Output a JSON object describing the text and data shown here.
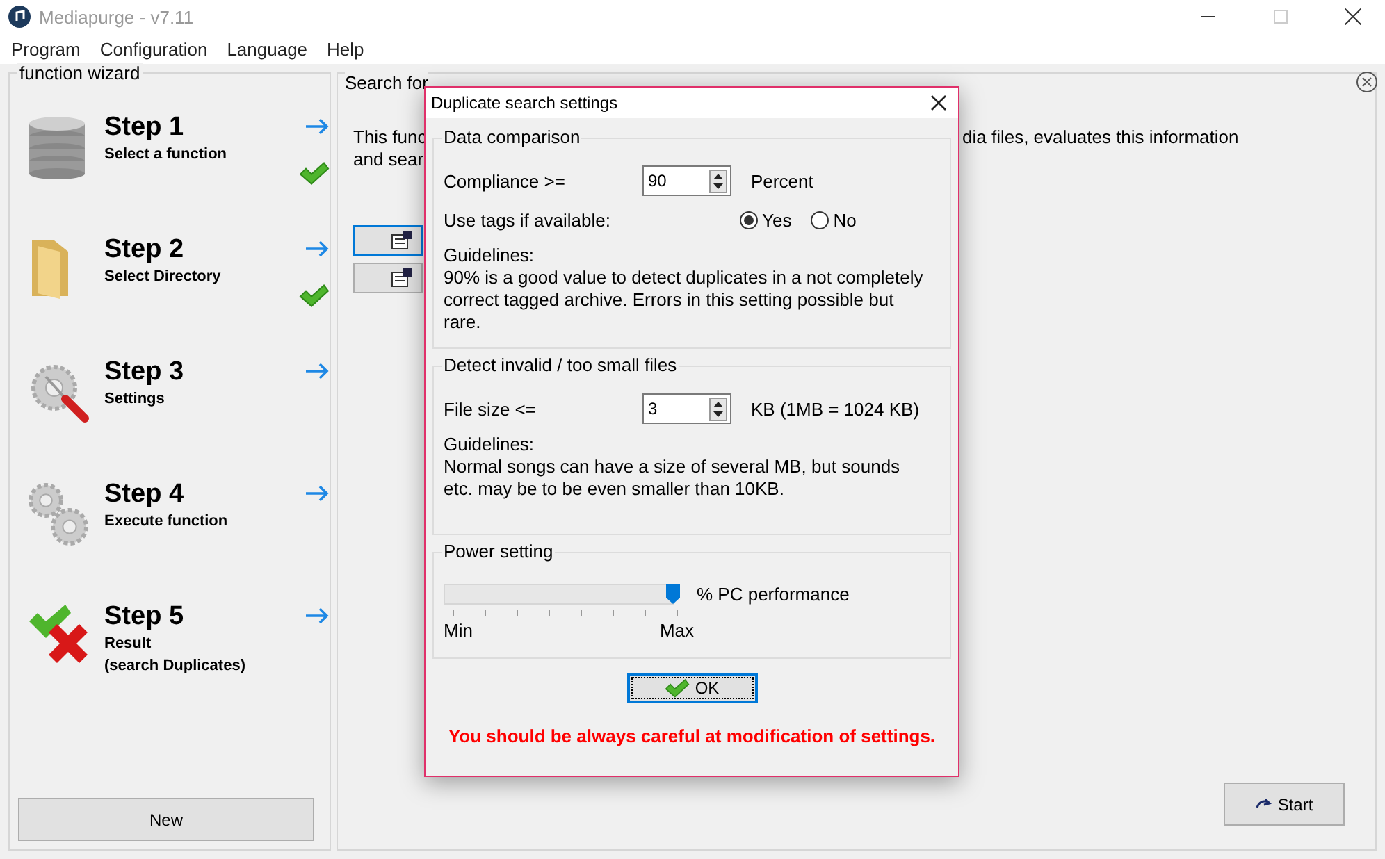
{
  "window": {
    "title": "Mediapurge - v7.11"
  },
  "menu": [
    {
      "label": "Program"
    },
    {
      "label": "Configuration"
    },
    {
      "label": "Language"
    },
    {
      "label": "Help"
    }
  ],
  "wizard": {
    "title": "function wizard",
    "steps": [
      {
        "kind": "database",
        "title": "Step 1",
        "subtitle": "Select a function",
        "done": true
      },
      {
        "kind": "folder",
        "title": "Step 2",
        "subtitle": "Select Directory",
        "done": true
      },
      {
        "kind": "settings",
        "title": "Step 3",
        "subtitle": "Settings",
        "done": false
      },
      {
        "kind": "execute",
        "title": "Step 4",
        "subtitle": "Execute function",
        "done": false
      },
      {
        "kind": "result",
        "title": "Step 5",
        "subtitle": "Result",
        "subtitle_2": "(search Duplicates)",
        "done": false
      }
    ],
    "new_button": "New"
  },
  "main": {
    "heading": "Search for",
    "description_left": [
      "This func",
      "and sear"
    ],
    "description_right": "dia files, evaluates this information",
    "start_button": "Start"
  },
  "dialog": {
    "title": "Duplicate search settings",
    "data_comparison": {
      "title": "Data comparison",
      "compliance": {
        "label": "Compliance >=",
        "value": "90",
        "unit": "Percent"
      },
      "tags": {
        "label": "Use tags if available:",
        "options": [
          {
            "label": "Yes",
            "selected": true
          },
          {
            "label": "No",
            "selected": false
          }
        ]
      },
      "guidelines_label": "Guidelines:",
      "guidelines": "90% is a good value to detect duplicates in a not completely correct tagged archive. Errors in this setting possible but rare."
    },
    "detect": {
      "title": "Detect invalid / too small files",
      "file_size": {
        "label": "File size <=",
        "value": "3",
        "unit": "KB (1MB = 1024 KB)"
      },
      "guidelines_label": "Guidelines:",
      "guidelines": "Normal songs can have a size of several MB, but sounds etc. may be to be even smaller than 10KB."
    },
    "power": {
      "title": "Power setting",
      "label": "% PC performance",
      "level": 1,
      "min_label": "Min",
      "max_label": "Max"
    },
    "ok_button": "OK",
    "warning": "You should be always careful at modification of settings."
  }
}
